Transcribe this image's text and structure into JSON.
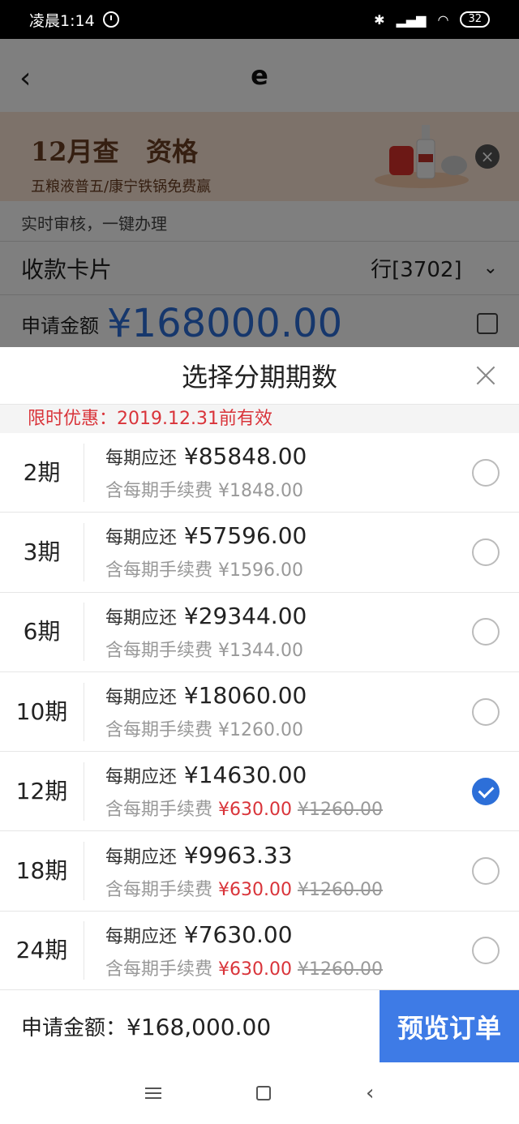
{
  "status_bar": {
    "time": "凌晨1:14",
    "battery": "32"
  },
  "background": {
    "nav_title": "e",
    "banner_line1": "12月查",
    "banner_line1b": "资格",
    "banner_line2": "五粮液普五/康宁铁锅免费赢",
    "subtitle": "实时审核，一键办理",
    "card_label": "收款卡片",
    "card_value": "行[3702]",
    "amount_label": "申请金额",
    "amount_value": "¥168000.00"
  },
  "sheet": {
    "title": "选择分期期数",
    "promo": "限时优惠：2019.12.31前有效",
    "per_label": "每期应还",
    "fee_label": "含每期手续费",
    "options": [
      {
        "period": "2期",
        "amount": "¥85848.00",
        "fee": "¥1848.00",
        "fee_old": "",
        "checked": false
      },
      {
        "period": "3期",
        "amount": "¥57596.00",
        "fee": "¥1596.00",
        "fee_old": "",
        "checked": false
      },
      {
        "period": "6期",
        "amount": "¥29344.00",
        "fee": "¥1344.00",
        "fee_old": "",
        "checked": false
      },
      {
        "period": "10期",
        "amount": "¥18060.00",
        "fee": "¥1260.00",
        "fee_old": "",
        "checked": false
      },
      {
        "period": "12期",
        "amount": "¥14630.00",
        "fee": "¥630.00",
        "fee_old": "¥1260.00",
        "checked": true
      },
      {
        "period": "18期",
        "amount": "¥9963.33",
        "fee": "¥630.00",
        "fee_old": "¥1260.00",
        "checked": false
      },
      {
        "period": "24期",
        "amount": "¥7630.00",
        "fee": "¥630.00",
        "fee_old": "¥1260.00",
        "checked": false
      }
    ]
  },
  "footer": {
    "total_label": "申请金额：",
    "total_value": "¥168,000.00",
    "button_label": "预览订单"
  },
  "colors": {
    "accent": "#3e7be6",
    "promo_red": "#d9343a"
  }
}
